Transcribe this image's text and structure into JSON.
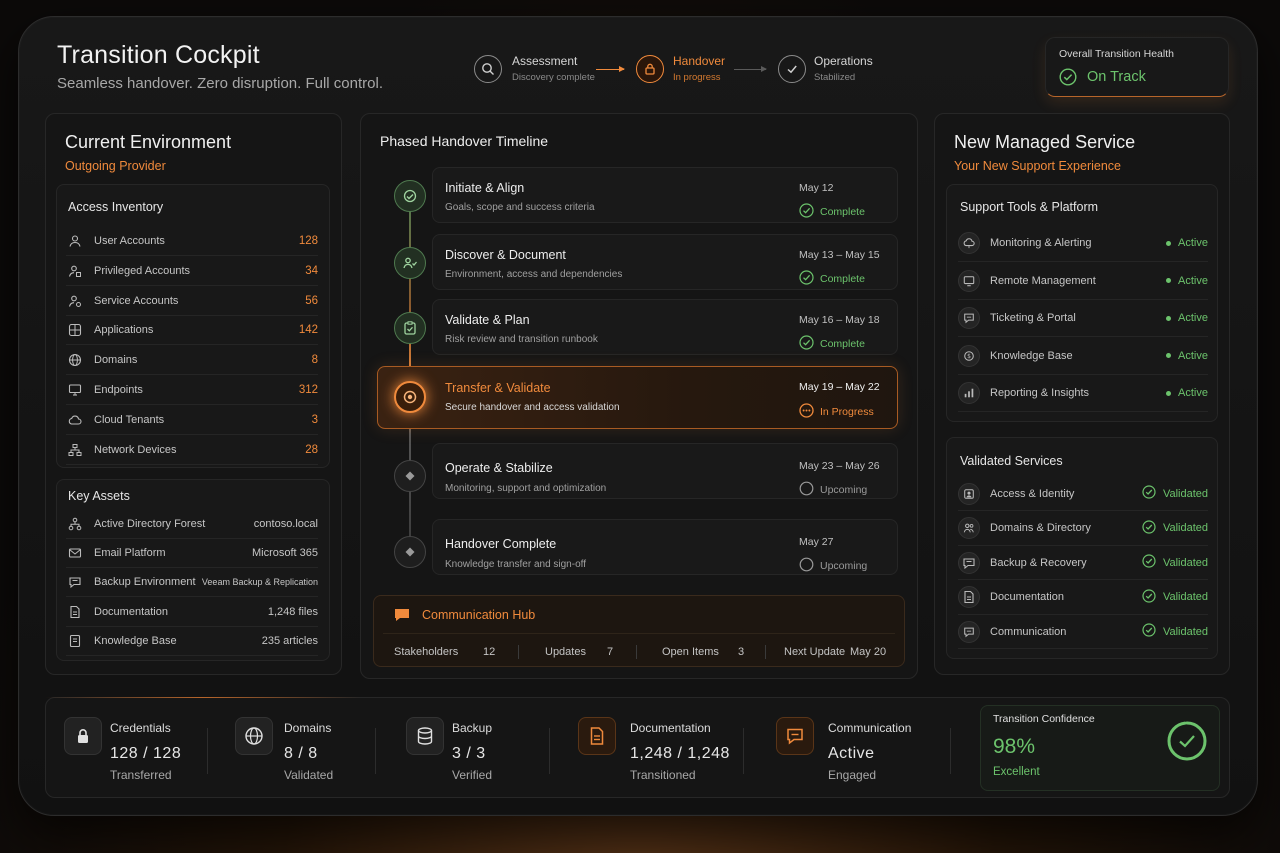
{
  "header": {
    "title": "Transition Cockpit",
    "subtitle": "Seamless handover. Zero disruption. Full control."
  },
  "stepper": [
    {
      "title": "Assessment",
      "sub": "Discovery complete",
      "icon": "search-icon",
      "state": "done"
    },
    {
      "title": "Handover",
      "sub": "In progress",
      "icon": "lock-icon",
      "state": "current"
    },
    {
      "title": "Operations",
      "sub": "Stabilized",
      "icon": "check-icon",
      "state": "upcoming"
    }
  ],
  "health": {
    "label": "Overall Transition Health",
    "status": "On Track"
  },
  "current_env": {
    "title": "Current Environment",
    "subtitle": "Outgoing Provider",
    "inventory": {
      "title": "Access Inventory",
      "items": [
        {
          "icon": "user-icon",
          "label": "User Accounts",
          "value": "128"
        },
        {
          "icon": "privileged-user-icon",
          "label": "Privileged Accounts",
          "value": "34"
        },
        {
          "icon": "service-user-icon",
          "label": "Service Accounts",
          "value": "56"
        },
        {
          "icon": "apps-grid-icon",
          "label": "Applications",
          "value": "142"
        },
        {
          "icon": "globe-icon",
          "label": "Domains",
          "value": "8"
        },
        {
          "icon": "monitor-icon",
          "label": "Endpoints",
          "value": "312"
        },
        {
          "icon": "cloud-icon",
          "label": "Cloud Tenants",
          "value": "3"
        },
        {
          "icon": "network-icon",
          "label": "Network Devices",
          "value": "28"
        }
      ]
    },
    "assets": {
      "title": "Key Assets",
      "items": [
        {
          "icon": "hierarchy-icon",
          "label": "Active Directory Forest",
          "value": "contoso.local"
        },
        {
          "icon": "mail-icon",
          "label": "Email Platform",
          "value": "Microsoft 365"
        },
        {
          "icon": "backup-icon",
          "label": "Backup Environment",
          "value": "Veeam Backup & Replication"
        },
        {
          "icon": "document-icon",
          "label": "Documentation",
          "value": "1,248 files"
        },
        {
          "icon": "book-icon",
          "label": "Knowledge Base",
          "value": "235 articles"
        }
      ]
    }
  },
  "timeline": {
    "title": "Phased Handover Timeline",
    "phases": [
      {
        "title": "Initiate & Align",
        "desc": "Goals, scope and success criteria",
        "date": "May 12",
        "status": "Complete",
        "state": "done",
        "icon": "handshake-icon"
      },
      {
        "title": "Discover & Document",
        "desc": "Environment, access and dependencies",
        "date": "May 13 – May 15",
        "status": "Complete",
        "state": "done",
        "icon": "people-icon"
      },
      {
        "title": "Validate & Plan",
        "desc": "Risk review and transition runbook",
        "date": "May 16 – May 18",
        "status": "Complete",
        "state": "done",
        "icon": "clipboard-icon"
      },
      {
        "title": "Transfer & Validate",
        "desc": "Secure handover and access validation",
        "date": "May 19 – May 22",
        "status": "In Progress",
        "state": "current",
        "icon": "target-icon"
      },
      {
        "title": "Operate & Stabilize",
        "desc": "Monitoring, support and optimization",
        "date": "May 23 – May 26",
        "status": "Upcoming",
        "state": "upcoming",
        "icon": "diamond-icon"
      },
      {
        "title": "Handover Complete",
        "desc": "Knowledge transfer and sign-off",
        "date": "May 27",
        "status": "Upcoming",
        "state": "upcoming",
        "icon": "diamond-icon"
      }
    ]
  },
  "hub": {
    "title": "Communication Hub",
    "stakeholders_label": "Stakeholders",
    "stakeholders_value": "12",
    "updates_label": "Updates",
    "updates_value": "7",
    "open_label": "Open Items",
    "open_value": "3",
    "next_label": "Next Update",
    "next_value": "May 20"
  },
  "managed": {
    "title": "New Managed Service",
    "subtitle": "Your New Support Experience",
    "tools": {
      "title": "Support Tools & Platform",
      "items": [
        {
          "icon": "cloud-monitor-icon",
          "label": "Monitoring & Alerting",
          "status": "Active"
        },
        {
          "icon": "remote-desktop-icon",
          "label": "Remote Management",
          "status": "Active"
        },
        {
          "icon": "ticket-icon",
          "label": "Ticketing & Portal",
          "status": "Active"
        },
        {
          "icon": "knowledge-icon",
          "label": "Knowledge Base",
          "status": "Active"
        },
        {
          "icon": "bar-chart-icon",
          "label": "Reporting & Insights",
          "status": "Active"
        }
      ]
    },
    "validated": {
      "title": "Validated Services",
      "items": [
        {
          "icon": "identity-icon",
          "label": "Access & Identity",
          "status": "Validated"
        },
        {
          "icon": "directory-icon",
          "label": "Domains & Directory",
          "status": "Validated"
        },
        {
          "icon": "backup-icon",
          "label": "Backup & Recovery",
          "status": "Validated"
        },
        {
          "icon": "document-icon",
          "label": "Documentation",
          "status": "Validated"
        },
        {
          "icon": "chat-icon",
          "label": "Communication",
          "status": "Validated"
        }
      ]
    }
  },
  "stats": [
    {
      "icon": "lock-icon",
      "label": "Credentials",
      "value": "128 / 128",
      "sub": "Transferred"
    },
    {
      "icon": "globe-icon",
      "label": "Domains",
      "value": "8 / 8",
      "sub": "Validated"
    },
    {
      "icon": "database-icon",
      "label": "Backup",
      "value": "3 / 3",
      "sub": "Verified"
    },
    {
      "icon": "document-icon",
      "label": "Documentation",
      "value": "1,248 / 1,248",
      "sub": "Transitioned"
    },
    {
      "icon": "chat-icon",
      "label": "Communication",
      "value": "Active",
      "sub": "Engaged"
    }
  ],
  "confidence": {
    "label": "Transition Confidence",
    "value": "98%",
    "sub": "Excellent",
    "fraction": 0.98
  },
  "colors": {
    "accent": "#f08a3c",
    "success": "#6cc36c",
    "background": "#111111"
  }
}
